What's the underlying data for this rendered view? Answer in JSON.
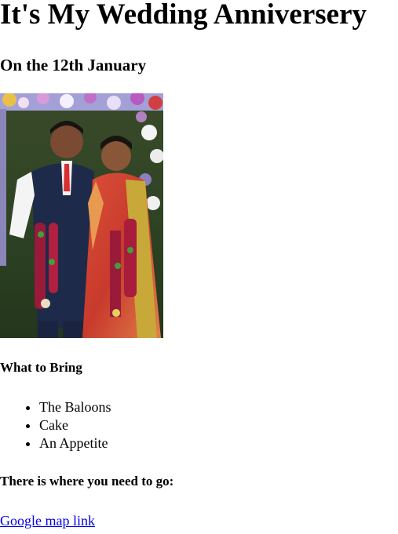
{
  "header": {
    "title": "It's My Wedding Anniversery",
    "subtitle": "On the 12th January"
  },
  "photo": {
    "subject": "couple-photo"
  },
  "bring": {
    "heading": "What to Bring",
    "items": [
      "The Baloons",
      "Cake",
      "An Appetite"
    ]
  },
  "directions": {
    "heading": "There is where you need to go:",
    "link_label": "Google map link"
  },
  "colors": {
    "link": "#0000ee",
    "text": "#000000",
    "background": "#ffffff"
  }
}
